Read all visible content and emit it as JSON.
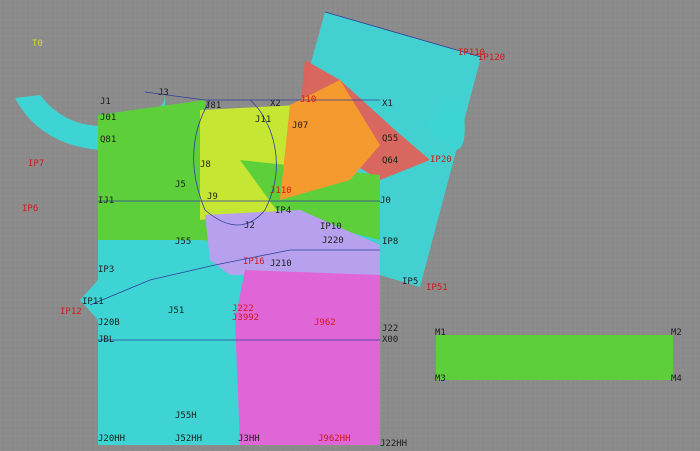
{
  "colors": {
    "background": "#8a8a8a",
    "grid": "#9a9a9a",
    "cyan": "#3fd4d4",
    "green": "#5ccf3a",
    "yellow_green": "#c5e632",
    "orange": "#f59a2e",
    "red": "#e0615a",
    "magenta": "#e066d8",
    "lavender": "#b7a0ee",
    "blue_line": "#2f3f9a",
    "label_dark": "#1e1e1e",
    "label_red": "#d01a1a",
    "label_yellow": "#d8d83a"
  },
  "labels": {
    "t0": "T0",
    "ip110": "IP110",
    "ip120": "IP120",
    "j1": "J1",
    "j3": "J3",
    "j01": "J01",
    "j81": "J81",
    "x2": "X2",
    "x1": "X1",
    "j11": "J11",
    "j07": "J07",
    "j10_t": "J10",
    "q81": "Q81",
    "q55": "Q55",
    "q64": "Q64",
    "ip20": "IP20",
    "ip7": "IP7",
    "ip6": "IP6",
    "ip8": "IP8",
    "ip4": "IP4",
    "ip3": "IP3",
    "ip10": "IP10",
    "ip5": "IP5",
    "ip51": "IP51",
    "ip12": "IP12",
    "ip11": "IP11",
    "ip16": "IP16",
    "j8": "J8",
    "j5": "J5",
    "j9": "J9",
    "j110": "J110",
    "j0": "J0",
    "ij1": "IJ1",
    "j55": "J55",
    "j2": "J2",
    "j220": "J220",
    "j210": "J210",
    "j9b": "J9",
    "j51": "J51",
    "j52": "J52",
    "j222": "J222",
    "j3992": "J3992",
    "j962": "J962",
    "j22": "J22",
    "j20b": "J20B",
    "jbl": "JBL",
    "x00": "X00",
    "j55h": "J55H",
    "j20hh": "J20HH",
    "j20h": "J20H",
    "j52hh": "J52HH",
    "j3hh": "J3HH",
    "j962hh": "J962HH",
    "j22hh": "J22HH",
    "m1": "M1",
    "m2": "M2",
    "m3": "M3",
    "m4": "M4"
  }
}
